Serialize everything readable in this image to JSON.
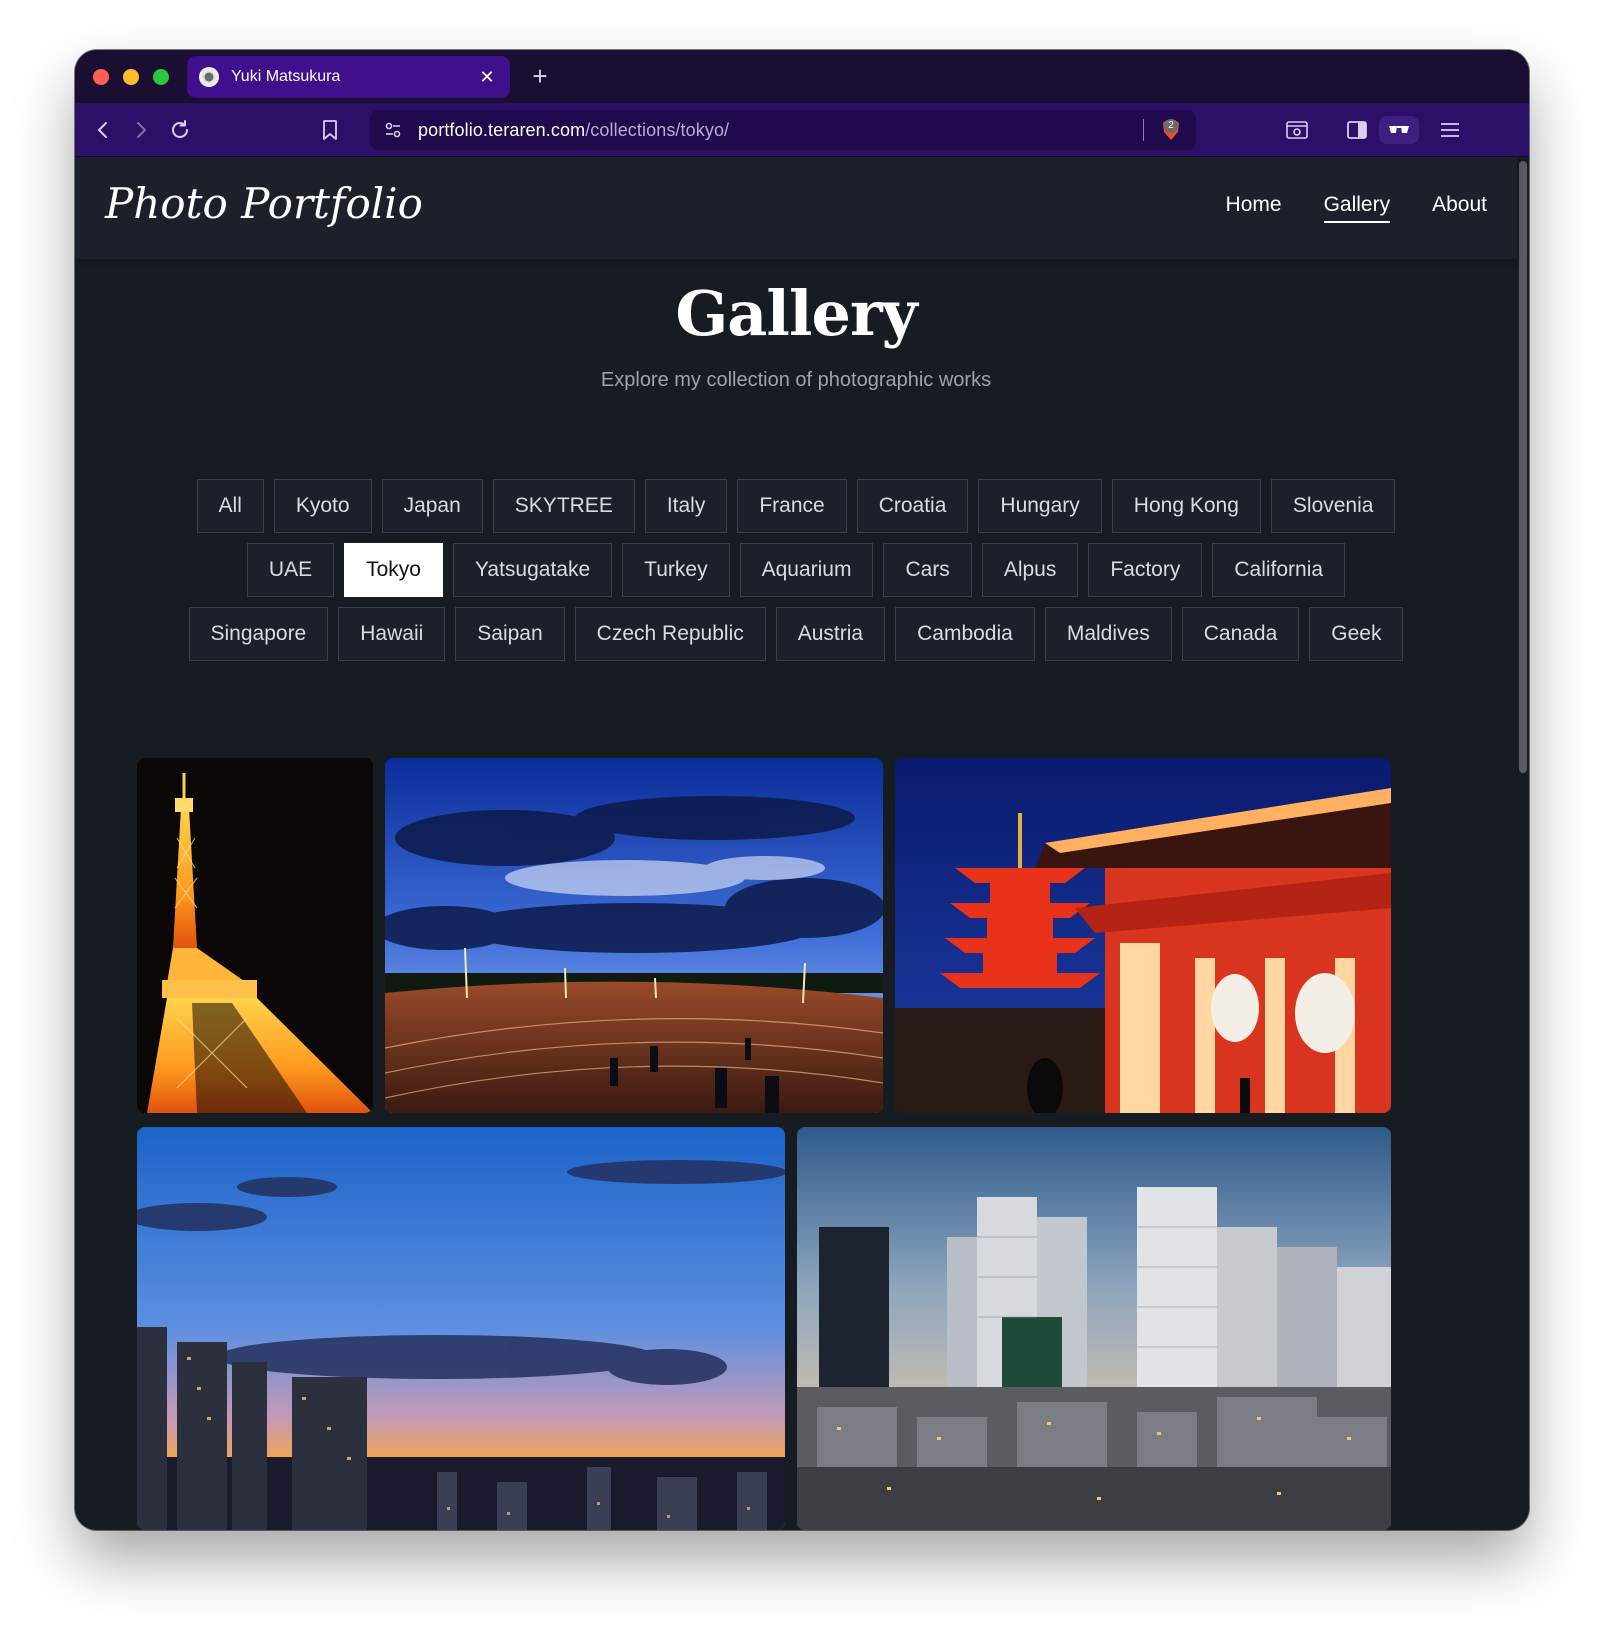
{
  "browser": {
    "tab_title": "Yuki Matsukura",
    "new_tab_label": "+",
    "url_host": "portfolio.teraren.com",
    "url_path": "/collections/tokyo/",
    "shields_count": "2"
  },
  "site": {
    "logo": "Photo Portfolio",
    "nav": [
      "Home",
      "Gallery",
      "About"
    ],
    "active_nav": "Gallery"
  },
  "gallery": {
    "title": "Gallery",
    "subtitle": "Explore my collection of photographic works",
    "active_filter": "Tokyo",
    "filter_rows": [
      [
        "All",
        "Kyoto",
        "Japan",
        "SKYTREE",
        "Italy",
        "France",
        "Croatia",
        "Hungary",
        "Hong Kong",
        "Slovenia"
      ],
      [
        "UAE",
        "Tokyo",
        "Yatsugatake",
        "Turkey",
        "Aquarium",
        "Cars",
        "Alpus",
        "Factory",
        "California"
      ],
      [
        "Singapore",
        "Hawaii",
        "Saipan",
        "Czech Republic",
        "Austria",
        "Cambodia",
        "Maldives",
        "Canada",
        "Geek"
      ]
    ],
    "photos": [
      {
        "subject": "tokyo-tower-night"
      },
      {
        "subject": "running-track-dusk"
      },
      {
        "subject": "sensoji-temple-night"
      },
      {
        "subject": "skyline-sunset"
      },
      {
        "subject": "shinjuku-skyscrapers"
      }
    ]
  },
  "colors": {
    "tab_active": "#3f0f8c",
    "toolbar": "#2a1066",
    "page_bg": "#171b22",
    "chip_active_bg": "#ffffff"
  }
}
